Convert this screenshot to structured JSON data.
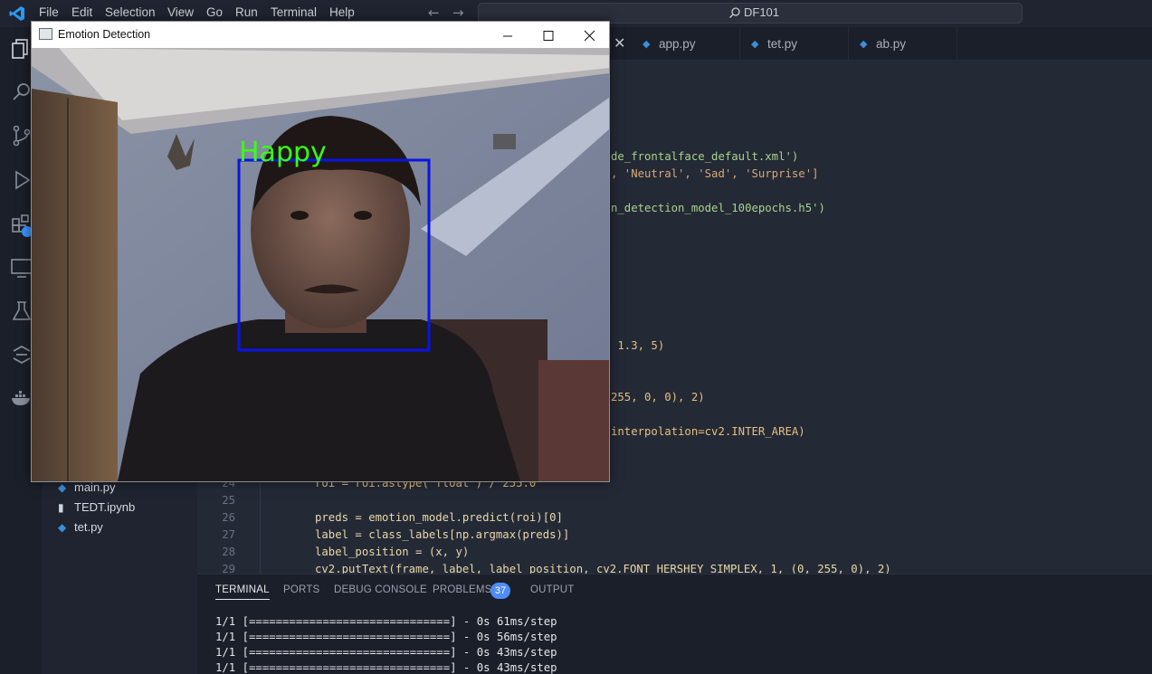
{
  "menubar": {
    "items": [
      "File",
      "Edit",
      "Selection",
      "View",
      "Go",
      "Run",
      "Terminal",
      "Help"
    ],
    "search": "DF101"
  },
  "tabs": [
    {
      "label": "app.py",
      "icon": "python-file-icon"
    },
    {
      "label": "tet.py",
      "icon": "python-file-icon"
    },
    {
      "label": "ab.py",
      "icon": "python-file-icon"
    }
  ],
  "sidebar": {
    "files": [
      {
        "label": "main.py",
        "icon": "python-file-icon"
      },
      {
        "label": "TEDT.ipynb",
        "icon": "notebook-file-icon"
      },
      {
        "label": "tet.py",
        "icon": "python-file-icon"
      }
    ],
    "badge": "4"
  },
  "editor": {
    "fragments": [
      "de_frontalface_default.xml')",
      ", 'Neutral', 'Sad', 'Surprise']",
      "n_detection_model_100epochs.h5')",
      " 1.3, 5)",
      "255, 0, 0), 2)",
      "interpolation=cv2.INTER_AREA)"
    ],
    "lines": [
      {
        "num": "24",
        "code": "roi = roi.astype('float') / 255.0"
      },
      {
        "num": "25",
        "code": ""
      },
      {
        "num": "26",
        "code": "preds = emotion_model.predict(roi)[0]"
      },
      {
        "num": "27",
        "code": "label = class_labels[np.argmax(preds)]"
      },
      {
        "num": "28",
        "code": "label_position = (x, y)"
      },
      {
        "num": "29",
        "code": "cv2.putText(frame, label, label_position, cv2.FONT_HERSHEY_SIMPLEX, 1, (0, 255, 0), 2)"
      }
    ]
  },
  "panel": {
    "tabs": [
      "TERMINAL",
      "PORTS",
      "DEBUG CONSOLE",
      "PROBLEMS",
      "OUTPUT"
    ],
    "problems_count": "37",
    "terminal_lines": [
      "1/1 [==============================] - 0s 61ms/step",
      "1/1 [==============================] - 0s 56ms/step",
      "1/1 [==============================] - 0s 43ms/step",
      "1/1 [==============================] - 0s 43ms/step"
    ]
  },
  "emotion_window": {
    "title": "Emotion Detection",
    "detected_label": "Happy",
    "label_color": "#39ff14",
    "box_color": "#0a14e6"
  },
  "colors": {
    "accent": "#3794ff",
    "background": "#1b1f29",
    "editor_bg": "#242936"
  }
}
